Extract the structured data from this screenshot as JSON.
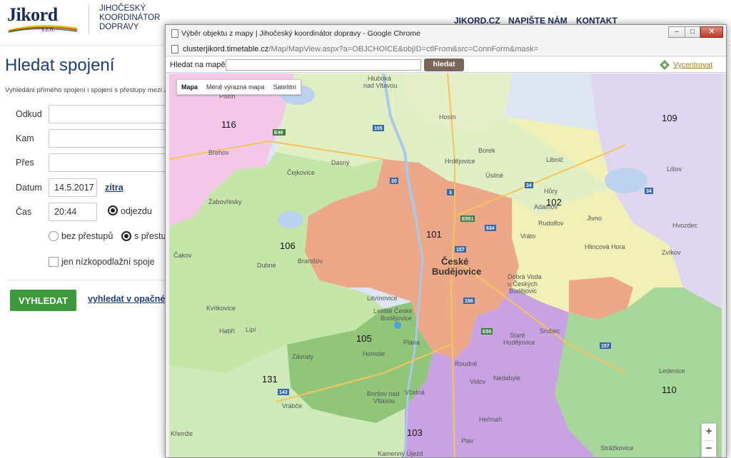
{
  "header": {
    "logo_word": "Jikord",
    "logo_sro": "s.r.o.",
    "company_line1": "JIHOČESKÝ",
    "company_line2": "KOORDINÁTOR",
    "company_line3": "DOPRAVY",
    "nav": [
      "JIKORD.CZ",
      "NAPIŠTE NÁM",
      "KONTAKT"
    ]
  },
  "form": {
    "title": "Hledat spojení",
    "subtitle": "Vyhledání přímého spojení i spojení s přestupy mezi z",
    "from_label": "Odkud",
    "to_label": "Kam",
    "via_label": "Přes",
    "date_label": "Datum",
    "date_value": "14.5.2017",
    "tomorrow_link": "zítra",
    "time_label": "Čas",
    "time_value": "20:44",
    "departure_option": "odjezdu",
    "no_transfer_option": "bez přestupů",
    "with_transfer_option": "s přestu",
    "low_floor_option": "jen nízkopodlažní spoje",
    "search_button": "VYHLEDAT",
    "reverse_link": "vyhledat v opačném"
  },
  "popup": {
    "window_title": "Výběr objektu z mapy | Jihočeský koordinátor dopravy - Google Chrome",
    "url_host": "clusterjikord.timetable.cz",
    "url_path": "/Map/MapView.aspx?a=OBJCHOICE&objID=ctlFrom&src=ConnForm&mask=",
    "search_label": "Hledat na mapě",
    "search_button": "hledat",
    "recenter_link": "Vycentrovat",
    "map_types": [
      "Mapa",
      "Méně výrazná mapa",
      "Satelitní"
    ],
    "zoom_in": "+",
    "zoom_out": "−"
  },
  "map": {
    "zones": [
      "116",
      "109",
      "102",
      "101",
      "106",
      "105",
      "131",
      "110",
      "103"
    ],
    "cities": [
      "České",
      "Budějovice"
    ],
    "places": [
      "Hluboká",
      "nad Vltavou",
      "Hosín",
      "Borek",
      "Hrdějovice",
      "Libníč",
      "Úsilné",
      "Dasný",
      "Čejkovice",
      "Břehov",
      "Žabovřesky",
      "Hůry",
      "Adamov",
      "Jivno",
      "Rudolfov",
      "Vráto",
      "Hlincová Hora",
      "Hvozdec",
      "Zvíkov",
      "Lišov",
      "Branišov",
      "Dubné",
      "Čakov",
      "Kvítkovice",
      "Habří",
      "Litvínovice",
      "Letiště České",
      "Budějovice",
      "Homole",
      "Plana",
      "Dobrá Voda",
      "u Českých",
      "Budějovic",
      "Srubec",
      "Staré",
      "Hodějovice",
      "Lipí",
      "Závraty",
      "Roudné",
      "Vidov",
      "Nedabyle",
      "Boršov nad",
      "Vltavou",
      "Včelná",
      "Vrábče",
      "Heřmaň",
      "Plav",
      "Ledenice",
      "Křemže",
      "Kamenný Újezd",
      "Strážkovice",
      "Pištín"
    ],
    "road_labels": [
      "E49",
      "105",
      "20",
      "634",
      "E551",
      "157",
      "156",
      "E55",
      "143",
      "34",
      "3",
      "157",
      "34"
    ]
  }
}
